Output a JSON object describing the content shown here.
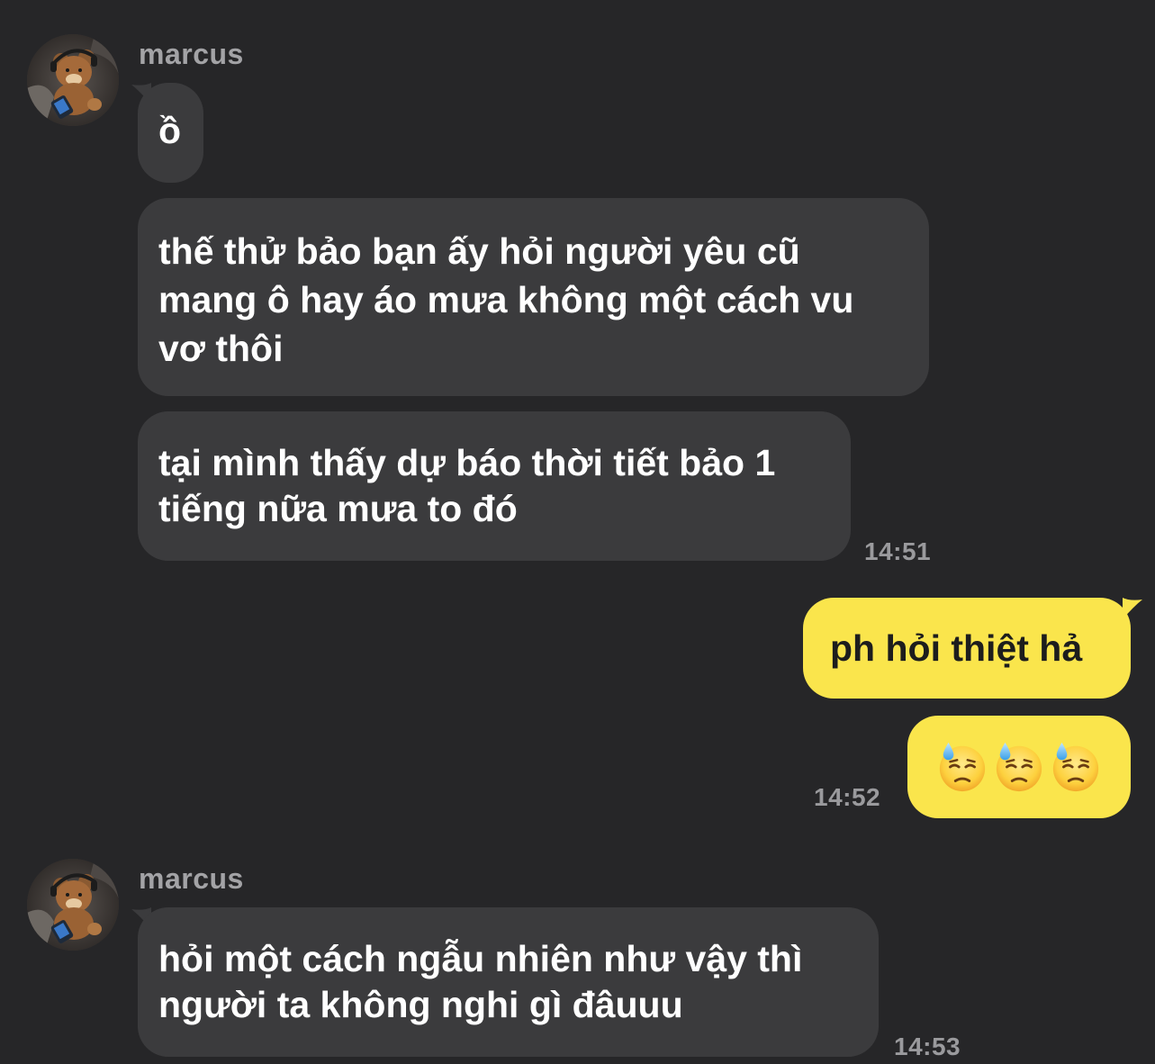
{
  "chat": {
    "groups": [
      {
        "sender": "marcus",
        "messages": [
          {
            "text": "ồ"
          },
          {
            "text": "thế thử bảo bạn ấy hỏi người yêu cũ\nmang ô hay áo mưa không một cách vu\nvơ thôi"
          },
          {
            "text": "tại mình thấy dự báo thời tiết bảo 1\ntiếng nữa mưa to đó"
          }
        ],
        "time": "14:51"
      },
      {
        "sender": "me",
        "messages": [
          {
            "text": "ph hỏi thiệt hả"
          },
          {
            "emoji": [
              "downcast-face-with-sweat",
              "downcast-face-with-sweat",
              "downcast-face-with-sweat"
            ]
          }
        ],
        "time": "14:52"
      },
      {
        "sender": "marcus",
        "messages": [
          {
            "text": "hỏi một cách ngẫu nhiên như vậy thì\nngười ta không nghi gì đâuuu"
          }
        ],
        "time": "14:53"
      }
    ]
  },
  "colors": {
    "background": "#262628",
    "incoming_bubble": "#3b3b3d",
    "outgoing_bubble": "#fae54c",
    "name_text": "#a3a3a6",
    "time_text": "#9a9a9d"
  },
  "icons": {
    "avatar": "teddy-bear-photo",
    "emoji": "downcast-face-with-sweat"
  }
}
